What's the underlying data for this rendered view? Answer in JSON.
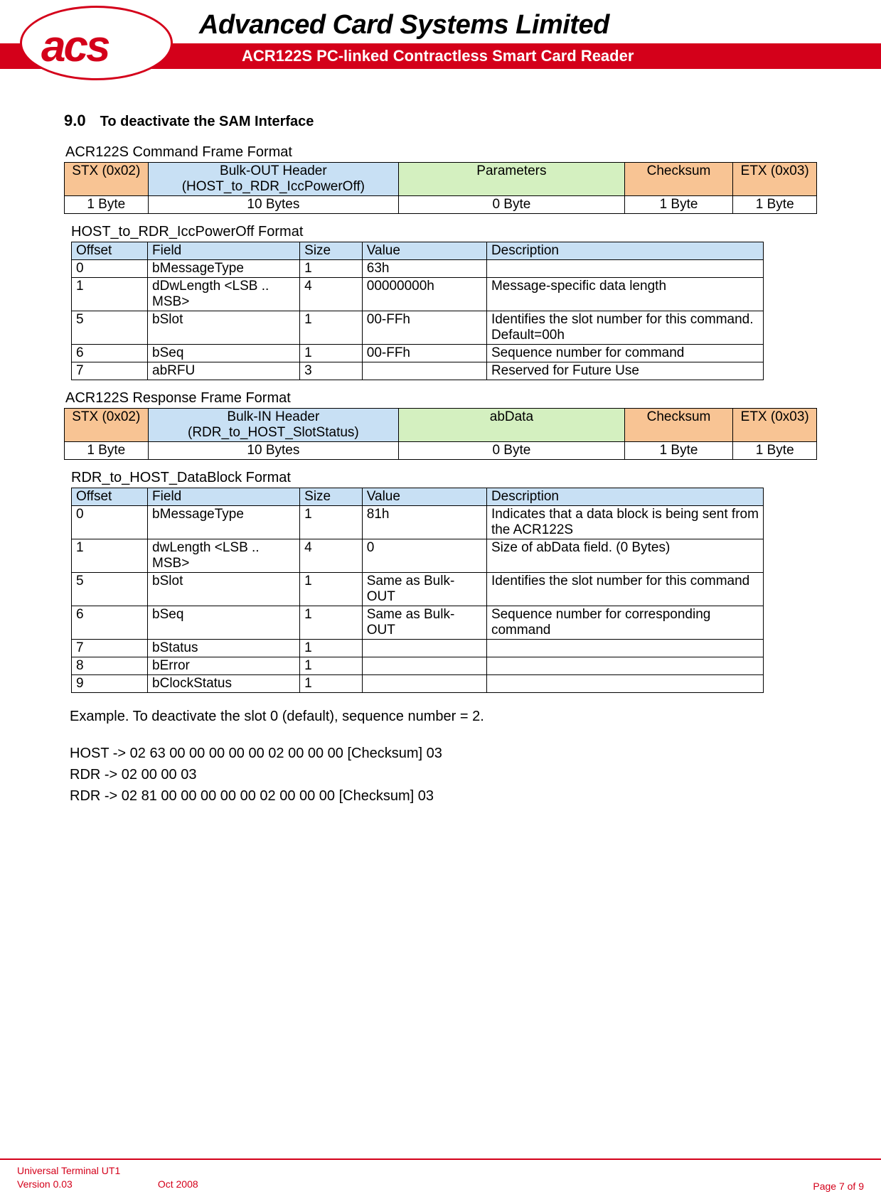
{
  "header": {
    "company": "Advanced Card Systems Limited",
    "product": "ACR122S PC-linked Contractless Smart Card Reader",
    "logo_text": "acs"
  },
  "section": {
    "number": "9.0",
    "title": "To deactivate the SAM Interface"
  },
  "table1": {
    "caption": "ACR122S Command Frame Format",
    "headers": [
      "STX (0x02)",
      "Bulk-OUT Header (HOST_to_RDR_IccPowerOff)",
      "Parameters",
      "Checksum",
      "ETX (0x03)"
    ],
    "row": [
      "1 Byte",
      "10 Bytes",
      "0 Byte",
      "1 Byte",
      "1 Byte"
    ]
  },
  "table2": {
    "caption": "HOST_to_RDR_IccPowerOff Format",
    "headers": [
      "Offset",
      "Field",
      "Size",
      "Value",
      "Description"
    ],
    "rows": [
      [
        "0",
        "bMessageType",
        "1",
        "63h",
        ""
      ],
      [
        "1",
        "dDwLength <LSB .. MSB>",
        "4",
        "00000000h",
        "Message-specific data length"
      ],
      [
        "5",
        "bSlot",
        "1",
        "00-FFh",
        "Identifies the slot number for this command. Default=00h"
      ],
      [
        "6",
        "bSeq",
        "1",
        "00-FFh",
        "Sequence number for command"
      ],
      [
        "7",
        "abRFU",
        "3",
        "",
        "Reserved for Future Use"
      ]
    ]
  },
  "table3": {
    "caption": "ACR122S Response Frame Format",
    "headers": [
      "STX (0x02)",
      "Bulk-IN Header (RDR_to_HOST_SlotStatus)",
      "abData",
      "Checksum",
      "ETX (0x03)"
    ],
    "row": [
      "1 Byte",
      "10 Bytes",
      "0 Byte",
      "1 Byte",
      "1 Byte"
    ]
  },
  "table4": {
    "caption": "RDR_to_HOST_DataBlock Format",
    "headers": [
      "Offset",
      "Field",
      "Size",
      "Value",
      "Description"
    ],
    "rows": [
      [
        "0",
        "bMessageType",
        "1",
        "81h",
        "Indicates that a data block is being sent from the ACR122S"
      ],
      [
        "1",
        "dwLength <LSB .. MSB>",
        "4",
        "0",
        "Size of abData field. (0 Bytes)"
      ],
      [
        "5",
        "bSlot",
        "1",
        "Same as Bulk-OUT",
        "Identifies the slot number for this command"
      ],
      [
        "6",
        "bSeq",
        "1",
        "Same as Bulk-OUT",
        "Sequence number for corresponding command"
      ],
      [
        "7",
        "bStatus",
        "1",
        "",
        ""
      ],
      [
        "8",
        "bError",
        "1",
        "",
        ""
      ],
      [
        "9",
        "bClockStatus",
        "1",
        "",
        ""
      ]
    ]
  },
  "example": {
    "intro": "Example. To deactivate the slot 0 (default), sequence number = 2.",
    "lines": [
      "HOST -> 02 63 00 00 00 00 00 02 00 00 00 [Checksum] 03",
      "RDR -> 02 00 00 03",
      "RDR  -> 02 81 00 00 00 00 00 02 00 00 00 [Checksum] 03"
    ]
  },
  "footer": {
    "line1": "Universal Terminal UT1",
    "line2": "Version 0.03",
    "date": "Oct 2008",
    "page": "Page 7 of 9"
  }
}
